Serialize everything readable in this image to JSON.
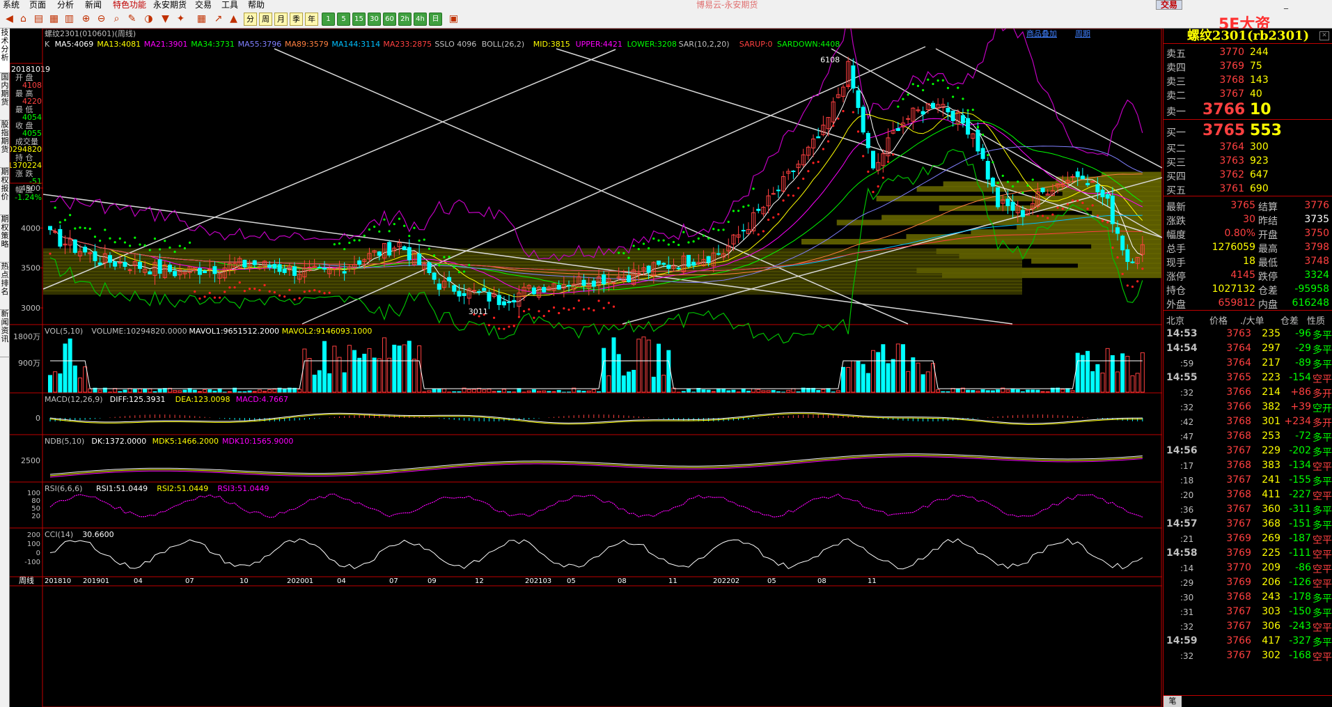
{
  "menu": {
    "items": [
      "系统",
      "页面",
      "分析",
      "新闻",
      "特色功能",
      "永安期货",
      "交易",
      "工具",
      "帮助"
    ],
    "app_title": "博易云-永安期货",
    "trade_button": "交易",
    "watermark": "5E大资5etz.com"
  },
  "toolbar": {
    "period_buttons": [
      "分",
      "5",
      "1",
      "5",
      "15",
      "30",
      "60",
      "2h",
      "4h",
      "日",
      "周",
      "月",
      "季",
      "年"
    ],
    "selected_period": "周"
  },
  "left_tabs": [
    "技术分析",
    "国内期货",
    "股指期货",
    "期权报价",
    "期权策略",
    "热点排名",
    "新闻资讯"
  ],
  "chart": {
    "header_links": {
      "overlay": "商品叠加",
      "period": "周期"
    },
    "title": "螺纹2301(010601)(周线)",
    "main_legend": [
      {
        "text": "K",
        "color": "#c0c0c0"
      },
      {
        "text": "MA5:4069",
        "color": "#ffffff"
      },
      {
        "text": "MA13:4081",
        "color": "#ffff00"
      },
      {
        "text": "MA21:3901",
        "color": "#ff00ff"
      },
      {
        "text": "MA34:3731",
        "color": "#00ff00"
      },
      {
        "text": "MA55:3796",
        "color": "#8080ff"
      },
      {
        "text": "MA89:3579",
        "color": "#ff8040"
      },
      {
        "text": "MA144:3114",
        "color": "#00c0ff"
      },
      {
        "text": "MA233:2875",
        "color": "#ff4040"
      },
      {
        "text": "SSLO 4096",
        "color": "#c0c0c0"
      },
      {
        "text": "BOLL(26,2)",
        "color": "#c0c0c0"
      },
      {
        "text": "MID:3815",
        "color": "#ffff00"
      },
      {
        "text": "UPPER:4421",
        "color": "#ff00ff"
      },
      {
        "text": "LOWER:3208",
        "color": "#00ff00"
      },
      {
        "text": "SAR(10,2,20)",
        "color": "#c0c0c0"
      },
      {
        "text": "SARUP:0",
        "color": "#ff4040"
      },
      {
        "text": "SARDOWN:4408",
        "color": "#00ff00"
      }
    ],
    "price_ticks": [
      "4500",
      "4000",
      "3500",
      "3000"
    ],
    "price_annotations": {
      "high": "6108",
      "low": "3011"
    },
    "info_box": {
      "date": "20181019",
      "rows": [
        {
          "label": "开 盘",
          "value": "4108",
          "color": "#ff4040"
        },
        {
          "label": "最 高",
          "value": "4220",
          "color": "#ff4040"
        },
        {
          "label": "最 低",
          "value": "4054",
          "color": "#00ff00"
        },
        {
          "label": "收 盘",
          "value": "4055",
          "color": "#00ff00"
        },
        {
          "label": "成交量",
          "value": "10294820",
          "color": "#ffff00"
        },
        {
          "label": "持 仓",
          "value": "1370224",
          "color": "#ffff00"
        },
        {
          "label": "涨 跌",
          "value": "-51",
          "color": "#00ff00"
        },
        {
          "label": "幅 度",
          "value": "-1.24%",
          "color": "#00ff00"
        }
      ]
    },
    "vol_legend": [
      {
        "text": "VOL(5,10)",
        "color": "#c0c0c0"
      },
      {
        "text": "VOLUME:10294820.0000",
        "color": "#c0c0c0"
      },
      {
        "text": "MAVOL1:9651512.2000",
        "color": "#ffffff"
      },
      {
        "text": "MAVOL2:9146093.1000",
        "color": "#ffff00"
      }
    ],
    "vol_ticks": [
      "1800万",
      "900万"
    ],
    "macd_legend": [
      {
        "text": "MACD(12,26,9)",
        "color": "#c0c0c0"
      },
      {
        "text": "DIFF:125.3931",
        "color": "#ffffff"
      },
      {
        "text": "DEA:123.0098",
        "color": "#ffff00"
      },
      {
        "text": "MACD:4.7667",
        "color": "#ff00ff"
      }
    ],
    "macd_ticks": [
      "0"
    ],
    "ndb_legend": [
      {
        "text": "NDB(5,10)",
        "color": "#c0c0c0"
      },
      {
        "text": "DK:1372.0000",
        "color": "#ffffff"
      },
      {
        "text": "MDK5:1466.2000",
        "color": "#ffff00"
      },
      {
        "text": "MDK10:1565.9000",
        "color": "#ff00ff"
      }
    ],
    "ndb_ticks": [
      "2500"
    ],
    "rsi_legend": [
      {
        "text": "RSI(6,6,6)",
        "color": "#c0c0c0"
      },
      {
        "text": "RSI1:51.0449",
        "color": "#ffffff"
      },
      {
        "text": "RSI2:51.0449",
        "color": "#ffff00"
      },
      {
        "text": "RSI3:51.0449",
        "color": "#ff00ff"
      }
    ],
    "rsi_ticks": [
      "100",
      "80",
      "50",
      "20"
    ],
    "cci_legend": [
      {
        "text": "CCI(14)",
        "color": "#c0c0c0"
      },
      {
        "text": "30.6600",
        "color": "#ffffff"
      }
    ],
    "cci_ticks": [
      "200",
      "100",
      "0",
      "-100"
    ],
    "x_axis_label": "周线",
    "x_ticks": [
      "201810",
      "201901",
      "04",
      "07",
      "10",
      "202001",
      "04",
      "07",
      "09",
      "12",
      "202103",
      "05",
      "08",
      "11",
      "202202",
      "05",
      "08",
      "11"
    ]
  },
  "quote": {
    "title": "螺纹2301(rb2301)",
    "asks": [
      {
        "label": "卖五",
        "price": "3770",
        "qty": "244"
      },
      {
        "label": "卖四",
        "price": "3769",
        "qty": "75"
      },
      {
        "label": "卖三",
        "price": "3768",
        "qty": "143"
      },
      {
        "label": "卖二",
        "price": "3767",
        "qty": "40"
      },
      {
        "label": "卖一",
        "price": "3766",
        "qty": "10"
      }
    ],
    "bids": [
      {
        "label": "买一",
        "price": "3765",
        "qty": "553"
      },
      {
        "label": "买二",
        "price": "3764",
        "qty": "300"
      },
      {
        "label": "买三",
        "price": "3763",
        "qty": "923"
      },
      {
        "label": "买四",
        "price": "3762",
        "qty": "647"
      },
      {
        "label": "买五",
        "price": "3761",
        "qty": "690"
      }
    ],
    "stats": [
      {
        "l1": "最新",
        "v1": "3765",
        "c1": "#ff4040",
        "l2": "结算",
        "v2": "3776",
        "c2": "#ff4040"
      },
      {
        "l1": "涨跌",
        "v1": "30",
        "c1": "#ff4040",
        "l2": "昨结",
        "v2": "3735",
        "c2": "#ffffff"
      },
      {
        "l1": "幅度",
        "v1": "0.80%",
        "c1": "#ff4040",
        "l2": "开盘",
        "v2": "3750",
        "c2": "#ff4040"
      },
      {
        "l1": "总手",
        "v1": "1276059",
        "c1": "#ffff00",
        "l2": "最高",
        "v2": "3798",
        "c2": "#ff4040"
      },
      {
        "l1": "现手",
        "v1": "18",
        "c1": "#ffff00",
        "l2": "最低",
        "v2": "3748",
        "c2": "#ff4040"
      },
      {
        "l1": "涨停",
        "v1": "4145",
        "c1": "#ff4040",
        "l2": "跌停",
        "v2": "3324",
        "c2": "#00ff00"
      },
      {
        "l1": "持仓",
        "v1": "1027132",
        "c1": "#ffff00",
        "l2": "仓差",
        "v2": "-95958",
        "c2": "#00ff00"
      },
      {
        "l1": "外盘",
        "v1": "659812",
        "c1": "#ff4040",
        "l2": "内盘",
        "v2": "616248",
        "c2": "#00ff00"
      }
    ],
    "tick_header": {
      "time": "北京",
      "price": "价格",
      "vol": "./大单",
      "chg": "仓差",
      "nature": "性质"
    },
    "ticks": [
      {
        "t": "14:53",
        "major": true,
        "p": "3763",
        "v": "235",
        "c": "-96",
        "n": "多平",
        "up": false
      },
      {
        "t": "14:54",
        "major": true,
        "p": "3764",
        "v": "297",
        "c": "-29",
        "n": "多平",
        "up": false
      },
      {
        "t": ":59",
        "major": false,
        "p": "3764",
        "v": "217",
        "c": "-89",
        "n": "多平",
        "up": false
      },
      {
        "t": "14:55",
        "major": true,
        "p": "3765",
        "v": "223",
        "c": "-154",
        "n": "空平",
        "up": true
      },
      {
        "t": ":32",
        "major": false,
        "p": "3766",
        "v": "214",
        "c": "+86",
        "n": "多开",
        "up": true
      },
      {
        "t": ":32",
        "major": false,
        "p": "3766",
        "v": "382",
        "c": "+39",
        "n": "空开",
        "up": false
      },
      {
        "t": ":42",
        "major": false,
        "p": "3768",
        "v": "301",
        "c": "+234",
        "n": "多开",
        "up": true
      },
      {
        "t": ":47",
        "major": false,
        "p": "3768",
        "v": "253",
        "c": "-72",
        "n": "多平",
        "up": false
      },
      {
        "t": "14:56",
        "major": true,
        "p": "3767",
        "v": "229",
        "c": "-202",
        "n": "多平",
        "up": false
      },
      {
        "t": ":17",
        "major": false,
        "p": "3768",
        "v": "383",
        "c": "-134",
        "n": "空平",
        "up": true
      },
      {
        "t": ":18",
        "major": false,
        "p": "3767",
        "v": "241",
        "c": "-155",
        "n": "多平",
        "up": false
      },
      {
        "t": ":20",
        "major": false,
        "p": "3768",
        "v": "411",
        "c": "-227",
        "n": "空平",
        "up": true
      },
      {
        "t": ":36",
        "major": false,
        "p": "3767",
        "v": "360",
        "c": "-311",
        "n": "多平",
        "up": false
      },
      {
        "t": "14:57",
        "major": true,
        "p": "3767",
        "v": "368",
        "c": "-151",
        "n": "多平",
        "up": false
      },
      {
        "t": ":21",
        "major": false,
        "p": "3769",
        "v": "269",
        "c": "-187",
        "n": "空平",
        "up": true
      },
      {
        "t": "14:58",
        "major": true,
        "p": "3769",
        "v": "225",
        "c": "-111",
        "n": "空平",
        "up": true
      },
      {
        "t": ":14",
        "major": false,
        "p": "3770",
        "v": "209",
        "c": "-86",
        "n": "空平",
        "up": true
      },
      {
        "t": ":29",
        "major": false,
        "p": "3769",
        "v": "206",
        "c": "-126",
        "n": "空平",
        "up": true
      },
      {
        "t": ":30",
        "major": false,
        "p": "3768",
        "v": "243",
        "c": "-178",
        "n": "多平",
        "up": false
      },
      {
        "t": ":31",
        "major": false,
        "p": "3767",
        "v": "303",
        "c": "-150",
        "n": "多平",
        "up": false
      },
      {
        "t": ":32",
        "major": false,
        "p": "3767",
        "v": "306",
        "c": "-243",
        "n": "空平",
        "up": true
      },
      {
        "t": "14:59",
        "major": true,
        "p": "3766",
        "v": "417",
        "c": "-327",
        "n": "多平",
        "up": false
      },
      {
        "t": ":32",
        "major": false,
        "p": "3767",
        "v": "302",
        "c": "-168",
        "n": "空平",
        "up": true
      }
    ],
    "dock_tab": "笔"
  },
  "colors": {
    "up": "#ff4040",
    "down": "#00ffff",
    "grid": "#c00000",
    "axis_text": "#c0c0c0"
  }
}
